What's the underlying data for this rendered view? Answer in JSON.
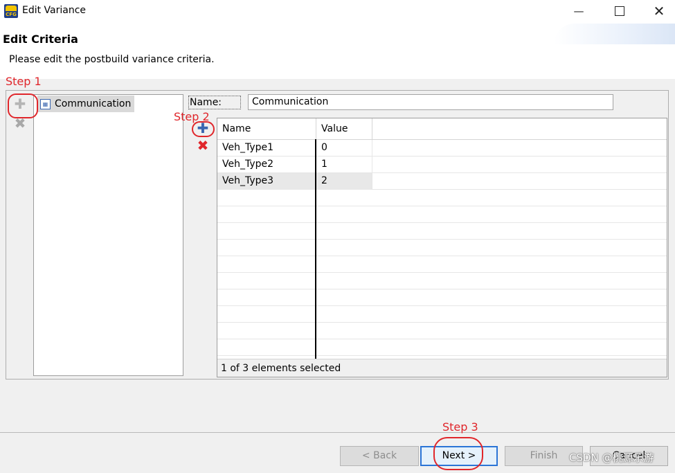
{
  "window": {
    "title": "Edit Variance",
    "app_icon_label": "CFG",
    "controls": [
      "minimize-icon",
      "maximize-icon",
      "close-icon"
    ]
  },
  "header": {
    "title": "Edit Criteria",
    "description": "Please edit the postbuild variance criteria."
  },
  "left_toolbar": {
    "add_icon": "plus-icon",
    "remove_icon": "x-icon"
  },
  "tree": {
    "items": [
      {
        "label": "Communication",
        "icon": "criteria-icon",
        "selected": true
      }
    ]
  },
  "form": {
    "name_label": "Name:",
    "name_value": "Communication"
  },
  "table_toolbar": {
    "add_icon": "plus-icon",
    "remove_icon": "x-icon",
    "remove_color": "#e0262b"
  },
  "table": {
    "columns": [
      "Name",
      "Value"
    ],
    "rows": [
      {
        "name": "Veh_Type1",
        "value": "0"
      },
      {
        "name": "Veh_Type2",
        "value": "1"
      },
      {
        "name": "Veh_Type3",
        "value": "2"
      }
    ],
    "selected_row": 3,
    "status": "1 of 3 elements selected"
  },
  "annotations": {
    "step1": "Step 1",
    "step2": "Step 2",
    "step3": "Step 3",
    "color": "#e0262b"
  },
  "buttons": {
    "back": "< Back",
    "next": "Next >",
    "finish": "Finish",
    "cancel": "Cancel"
  },
  "watermark": "CSDN @桃源乐游"
}
